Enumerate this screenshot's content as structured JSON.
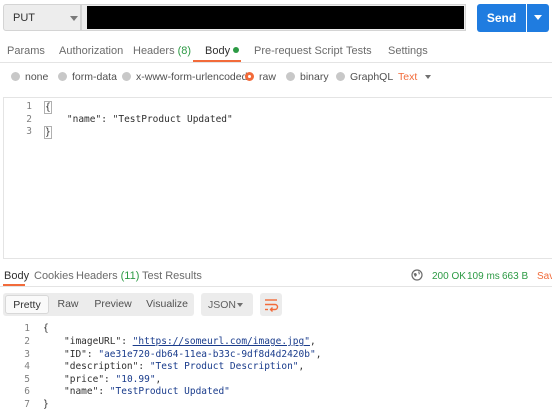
{
  "request": {
    "method": "PUT",
    "send_label": "Send",
    "tabs": [
      {
        "label": "Params"
      },
      {
        "label": "Authorization"
      },
      {
        "label": "Headers",
        "count": "(8)"
      },
      {
        "label": "Body"
      },
      {
        "label": "Pre-request Script"
      },
      {
        "label": "Tests"
      },
      {
        "label": "Settings"
      }
    ],
    "body_types": [
      "none",
      "form-data",
      "x-www-form-urlencoded",
      "raw",
      "binary",
      "GraphQL"
    ],
    "selected_body_type": "raw",
    "text_mode": "Text",
    "editor_lines": [
      "{",
      "    \"name\": \"TestProduct Updated\"",
      "}"
    ]
  },
  "response": {
    "tabs": [
      {
        "label": "Body"
      },
      {
        "label": "Cookies"
      },
      {
        "label": "Headers",
        "count": "(11)"
      },
      {
        "label": "Test Results"
      }
    ],
    "status": "200 OK",
    "time": "109 ms",
    "size": "663 B",
    "save_label": "Save",
    "views": [
      "Pretty",
      "Raw",
      "Preview",
      "Visualize"
    ],
    "active_view": "Pretty",
    "format": "JSON",
    "body": {
      "open": "{",
      "close": "}",
      "fields": [
        {
          "key": "\"imageURL\"",
          "value": "\"https://someurl.com/image.jpg\"",
          "is_link": true
        },
        {
          "key": "\"ID\"",
          "value": "\"ae31e720-db64-11ea-b33c-9df8d4d2420b\""
        },
        {
          "key": "\"description\"",
          "value": "\"Test Product Description\""
        },
        {
          "key": "\"price\"",
          "value": "\"10.99\""
        },
        {
          "key": "\"name\"",
          "value": "\"TestProduct Updated\"",
          "last": true
        }
      ]
    }
  },
  "colors": {
    "accent": "#f26b3a",
    "send": "#1f7ce0",
    "success": "#2c9a44",
    "string": "#1a3c8c"
  }
}
